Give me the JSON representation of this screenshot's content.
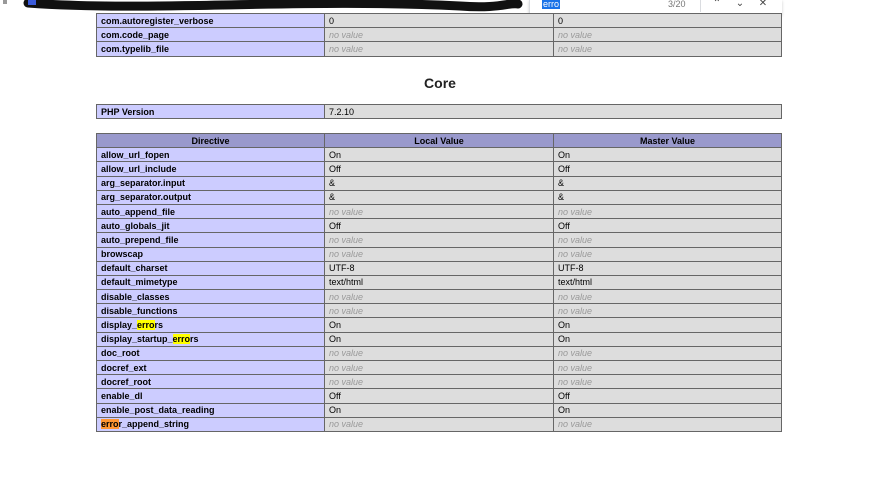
{
  "find_bar": {
    "query": "erro",
    "count": "3/20",
    "prev_glyph": "⌃",
    "next_glyph": "⌄",
    "close_glyph": "✕"
  },
  "top_table": {
    "rows": [
      {
        "directive": "com.autoregister_verbose",
        "local": "0",
        "master": "0"
      },
      {
        "directive": "com.code_page",
        "local": "no value",
        "master": "no value"
      },
      {
        "directive": "com.typelib_file",
        "local": "no value",
        "master": "no value"
      }
    ]
  },
  "section_title": "Core",
  "version_row": {
    "label": "PHP Version",
    "value": "7.2.10"
  },
  "core_table": {
    "headers": [
      "Directive",
      "Local Value",
      "Master Value"
    ],
    "rows": [
      {
        "d_pre": "allow_url_fopen",
        "d_hl": "",
        "d_post": "",
        "local": "On",
        "master": "On"
      },
      {
        "d_pre": "allow_url_include",
        "d_hl": "",
        "d_post": "",
        "local": "Off",
        "master": "Off"
      },
      {
        "d_pre": "arg_separator.input",
        "d_hl": "",
        "d_post": "",
        "local": "&",
        "master": "&"
      },
      {
        "d_pre": "arg_separator.output",
        "d_hl": "",
        "d_post": "",
        "local": "&",
        "master": "&"
      },
      {
        "d_pre": "auto_append_file",
        "d_hl": "",
        "d_post": "",
        "local": "no value",
        "master": "no value"
      },
      {
        "d_pre": "auto_globals_jit",
        "d_hl": "",
        "d_post": "",
        "local": "Off",
        "master": "Off"
      },
      {
        "d_pre": "auto_prepend_file",
        "d_hl": "",
        "d_post": "",
        "local": "no value",
        "master": "no value"
      },
      {
        "d_pre": "browscap",
        "d_hl": "",
        "d_post": "",
        "local": "no value",
        "master": "no value"
      },
      {
        "d_pre": "default_charset",
        "d_hl": "",
        "d_post": "",
        "local": "UTF-8",
        "master": "UTF-8"
      },
      {
        "d_pre": "default_mimetype",
        "d_hl": "",
        "d_post": "",
        "local": "text/html",
        "master": "text/html"
      },
      {
        "d_pre": "disable_classes",
        "d_hl": "",
        "d_post": "",
        "local": "no value",
        "master": "no value"
      },
      {
        "d_pre": "disable_functions",
        "d_hl": "",
        "d_post": "",
        "local": "no value",
        "master": "no value"
      },
      {
        "d_pre": "display_",
        "d_hl": "erro",
        "d_post": "rs",
        "local": "On",
        "master": "On"
      },
      {
        "d_pre": "display_startup_",
        "d_hl": "erro",
        "d_post": "rs",
        "local": "On",
        "master": "On"
      },
      {
        "d_pre": "doc_root",
        "d_hl": "",
        "d_post": "",
        "local": "no value",
        "master": "no value"
      },
      {
        "d_pre": "docref_ext",
        "d_hl": "",
        "d_post": "",
        "local": "no value",
        "master": "no value"
      },
      {
        "d_pre": "docref_root",
        "d_hl": "",
        "d_post": "",
        "local": "no value",
        "master": "no value"
      },
      {
        "d_pre": "enable_dl",
        "d_hl": "",
        "d_post": "",
        "local": "Off",
        "master": "Off"
      },
      {
        "d_pre": "enable_post_data_reading",
        "d_hl": "",
        "d_post": "",
        "local": "On",
        "master": "On"
      },
      {
        "d_pre": "",
        "d_hl": "erro",
        "d_post": "r_append_string",
        "local": "no value",
        "master": "no value",
        "active": true
      }
    ]
  },
  "colors": {
    "header_bg": "#9999cc",
    "directive_bg": "#ccccff",
    "value_bg": "#dddddd",
    "find_highlight": "#ffff00",
    "find_active_highlight": "#ff9632",
    "find_query_bg": "#1a73e8"
  }
}
